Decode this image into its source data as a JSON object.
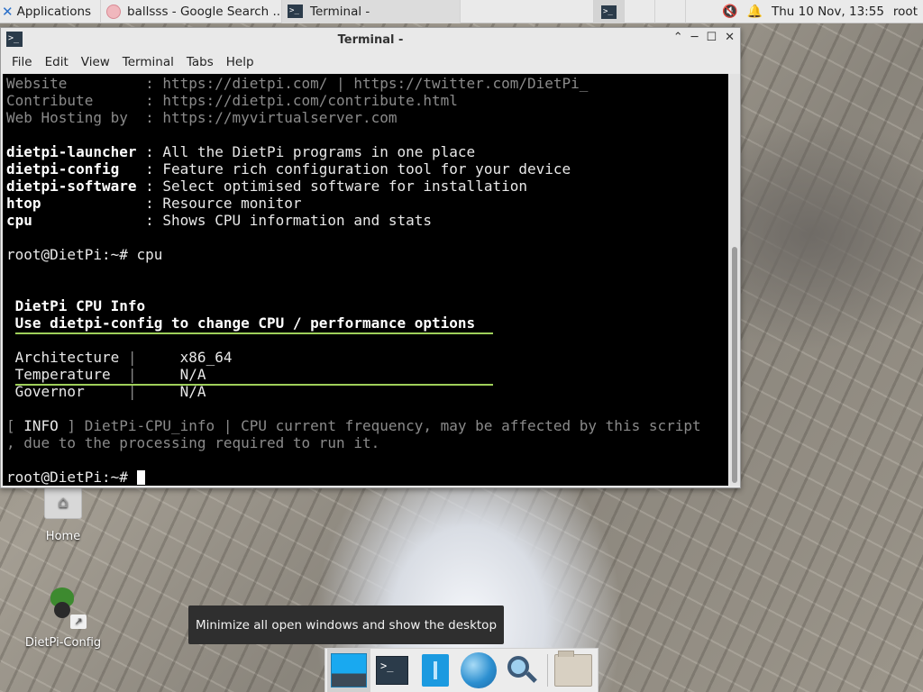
{
  "top_panel": {
    "apps_label": "Applications",
    "tasks": [
      {
        "label": "ballsss - Google Search ..."
      },
      {
        "label": "Terminal -"
      }
    ],
    "clock": "Thu 10 Nov, 13:55",
    "user": "root"
  },
  "window": {
    "title": "Terminal -",
    "menu": [
      "File",
      "Edit",
      "View",
      "Terminal",
      "Tabs",
      "Help"
    ]
  },
  "terminal": {
    "lines": [
      {
        "parts": [
          [
            "dim",
            "Website         : https://dietpi.com/ | https://twitter.com/DietPi_"
          ]
        ]
      },
      {
        "parts": [
          [
            "dim",
            "Contribute      : https://dietpi.com/contribute.html"
          ]
        ]
      },
      {
        "parts": [
          [
            "dim",
            "Web Hosting by  : https://myvirtualserver.com"
          ]
        ]
      },
      {
        "parts": []
      },
      {
        "parts": [
          [
            "bold",
            "dietpi-launcher"
          ],
          [
            "",
            " : All the DietPi programs in one place"
          ]
        ]
      },
      {
        "parts": [
          [
            "bold",
            "dietpi-config"
          ],
          [
            "",
            "   : Feature rich configuration tool for your device"
          ]
        ]
      },
      {
        "parts": [
          [
            "bold",
            "dietpi-software"
          ],
          [
            "",
            " : Select optimised software for installation"
          ]
        ]
      },
      {
        "parts": [
          [
            "bold",
            "htop"
          ],
          [
            "",
            "            : Resource monitor"
          ]
        ]
      },
      {
        "parts": [
          [
            "bold",
            "cpu"
          ],
          [
            "",
            "             : Shows CPU information and stats"
          ]
        ]
      },
      {
        "parts": []
      },
      {
        "parts": [
          [
            "",
            "root@DietPi:~# cpu"
          ]
        ]
      },
      {
        "parts": []
      },
      {
        "parts": []
      },
      {
        "parts": [
          [
            "bold",
            " DietPi CPU Info"
          ]
        ]
      },
      {
        "parts": [
          [
            "dim bold",
            " Use dietpi-config to change CPU / performance options"
          ]
        ]
      },
      {
        "parts": []
      },
      {
        "parts": [
          [
            "",
            " Architecture "
          ],
          [
            "dim",
            "|"
          ],
          [
            "",
            "     x86_64"
          ]
        ]
      },
      {
        "parts": [
          [
            "",
            " Temperature  "
          ],
          [
            "dim",
            "|"
          ],
          [
            "",
            "     N/A"
          ]
        ]
      },
      {
        "parts": [
          [
            "",
            " Governor     "
          ],
          [
            "dim",
            "|"
          ],
          [
            "",
            "     N/A"
          ]
        ]
      },
      {
        "parts": []
      },
      {
        "parts": [
          [
            "dim",
            "[ "
          ],
          [
            "",
            "INFO"
          ],
          [
            "dim",
            " ] DietPi-CPU_info | CPU current frequency, may be affected by this script"
          ]
        ]
      },
      {
        "parts": [
          [
            "dim",
            ", due to the processing required to run it."
          ]
        ]
      },
      {
        "parts": []
      },
      {
        "parts": [
          [
            "",
            "root@DietPi:~# "
          ],
          [
            "cursor",
            ""
          ]
        ]
      }
    ]
  },
  "desktop": {
    "icons": [
      {
        "label": "Home"
      },
      {
        "label": "DietPi-Config"
      }
    ]
  },
  "tooltip": "Minimize all open windows and show the desktop",
  "dock": {
    "items": [
      "show-desktop",
      "terminal",
      "file-manager",
      "web-browser",
      "app-finder",
      "folder"
    ]
  },
  "colors": {
    "terminal_bg": "#000000",
    "rule_green": "#9fd05a",
    "dim_text": "#8a8a8a"
  }
}
